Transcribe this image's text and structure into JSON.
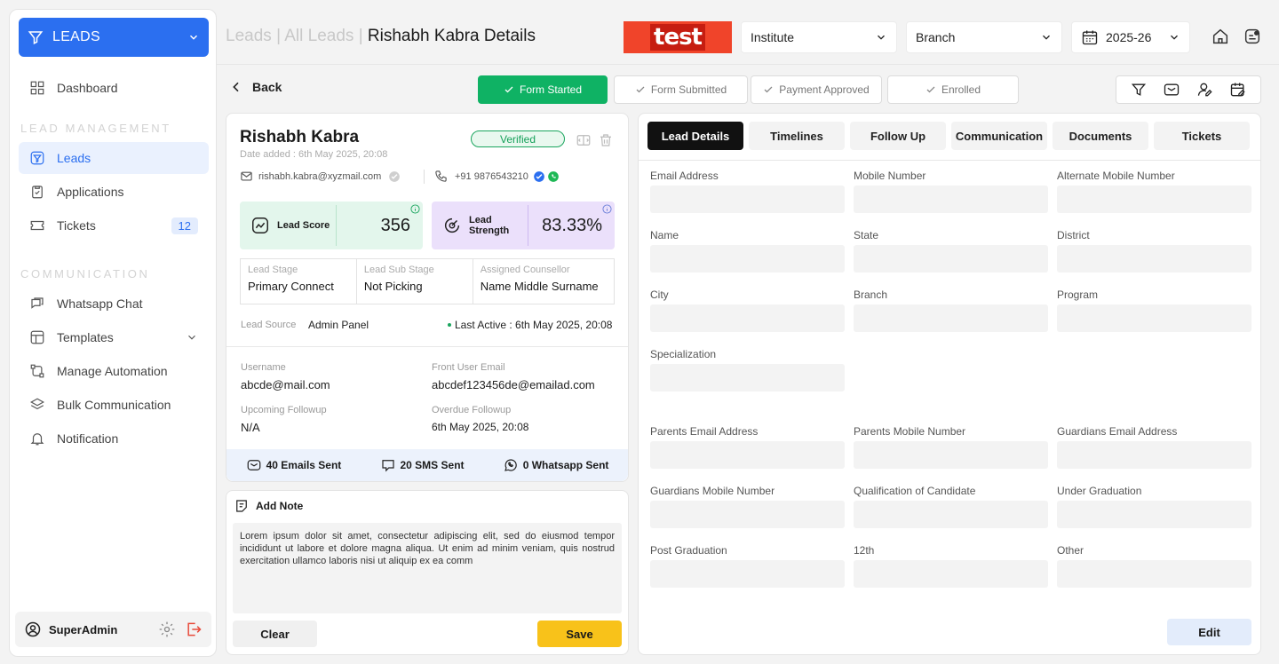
{
  "sidebar": {
    "module_label": "LEADS",
    "items": [
      {
        "label": "Dashboard"
      },
      {
        "label": "Leads"
      },
      {
        "label": "Applications"
      },
      {
        "label": "Tickets",
        "badge": "12"
      },
      {
        "label": "Whatsapp Chat"
      },
      {
        "label": "Templates"
      },
      {
        "label": "Manage Automation"
      },
      {
        "label": "Bulk Communication"
      },
      {
        "label": "Notification"
      }
    ],
    "section_lead_management": "LEAD MANAGEMENT",
    "section_communication": "COMMUNICATION",
    "user": "SuperAdmin"
  },
  "header": {
    "crumb_1": "Leads",
    "crumb_sep_1": "|",
    "crumb_2": "All Leads",
    "crumb_sep_2": "|",
    "crumb_current": "Rishabh Kabra Details",
    "logo_text": "test",
    "institute": "Institute",
    "branch": "Branch",
    "year": "2025-26"
  },
  "status": {
    "back_label": "Back",
    "steps": [
      "Form Started",
      "Form Submitted",
      "Payment Approved",
      "Enrolled"
    ]
  },
  "lead": {
    "name": "Rishabh Kabra",
    "date_added": "Date added : 6th May 2025, 20:08",
    "verified": "Verified",
    "email": "rishabh.kabra@xyzmail.com",
    "phone": "+91 9876543210",
    "score_label": "Lead Score",
    "score_value": "356",
    "strength_label": "Lead Strength",
    "strength_value": "83.33%",
    "stage_k": "Lead Stage",
    "stage_v": "Primary Connect",
    "sub_stage_k": "Lead Sub Stage",
    "sub_stage_v": "Not Picking",
    "counsellor_k": "Assigned Counsellor",
    "counsellor_v": "Name Middle Surname",
    "source_k": "Lead Source",
    "source_v": "Admin Panel",
    "last_active": "Last Active : 6th May 2025, 20:08",
    "username_k": "Username",
    "username_v": "abcde@mail.com",
    "front_email_k": "Front User Email",
    "front_email_v": "abcdef123456de@emailad.com",
    "upcoming_k": "Upcoming Followup",
    "upcoming_v": "N/A",
    "overdue_k": "Overdue Followup",
    "overdue_v": "6th May 2025, 20:08",
    "emails_sent": "40 Emails Sent",
    "sms_sent": "20 SMS Sent",
    "whatsapp_sent": "0 Whatsapp Sent"
  },
  "note": {
    "title": "Add Note",
    "text": "Lorem ipsum dolor sit amet, consectetur adipiscing elit, sed do eiusmod tempor incididunt ut labore et dolore magna aliqua. Ut enim ad minim veniam, quis nostrud exercitation ullamco laboris nisi ut aliquip ex ea comm",
    "clear_label": "Clear",
    "save_label": "Save"
  },
  "details": {
    "tabs": [
      "Lead Details",
      "Timelines",
      "Follow Up",
      "Communication",
      "Documents",
      "Tickets"
    ],
    "fields": [
      "Email Address",
      "Mobile Number",
      "Alternate Mobile Number",
      "Name",
      "State",
      "District",
      "City",
      "Branch",
      "Program",
      "Specialization",
      "Parents Email Address",
      "Parents Mobile Number",
      "Guardians Email Address",
      "Guardians Mobile Number",
      "Qualification of Candidate",
      "Under Graduation",
      "Post Graduation",
      "12th",
      "Other"
    ],
    "edit_label": "Edit"
  },
  "colors": {
    "accent": "#2b6ff0",
    "success": "#0fb264",
    "save": "#f8c21a",
    "score_bg": "#e3f6ec",
    "strength_bg": "#ebe0fb"
  }
}
